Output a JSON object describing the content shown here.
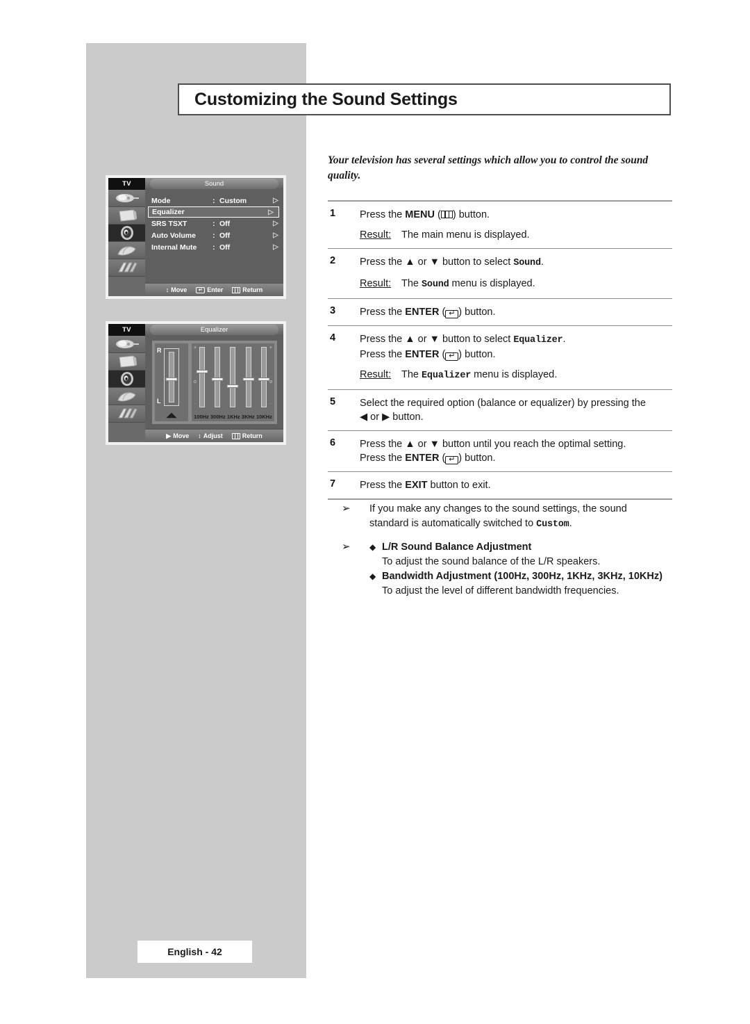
{
  "page": {
    "title": "Customizing the Sound Settings",
    "intro": "Your television has several settings which allow you to control the sound quality.",
    "footer": "English - 42"
  },
  "steps": [
    {
      "num": "1",
      "line1_pre": "Press the ",
      "line1_bold": "MENU",
      "line1_post": " button.",
      "icon": "menu-icon",
      "result_label": "Result:",
      "result_pre": "The main menu is displayed.",
      "result_mono": "",
      "result_post": ""
    },
    {
      "num": "2",
      "line1_pre": "Press the ",
      "line1_arrows": "▲ or ▼",
      "line1_mid": " button to select ",
      "line1_mono": "Sound",
      "line1_post": ".",
      "result_label": "Result:",
      "result_pre": "The ",
      "result_mono": "Sound",
      "result_post": " menu is displayed."
    },
    {
      "num": "3",
      "line1_pre": "Press the ",
      "line1_bold": "ENTER",
      "line1_post": " button.",
      "icon": "enter-icon"
    },
    {
      "num": "4",
      "line1_pre": "Press the ",
      "line1_arrows": "▲ or ▼",
      "line1_mid": " button to select ",
      "line1_mono": "Equalizer",
      "line1_post": ".",
      "line2_pre": "Press the ",
      "line2_bold": "ENTER",
      "line2_post": " button.",
      "result_label": "Result:",
      "result_pre": "The ",
      "result_mono": "Equalizer",
      "result_post": " menu is displayed."
    },
    {
      "num": "5",
      "text_l1": "Select the required option (balance or equalizer) by pressing the",
      "text_l2": "◀ or ▶ button."
    },
    {
      "num": "6",
      "line1_pre": "Press the ",
      "line1_arrows": "▲ or ▼",
      "line1_mid": " button until you reach the optimal setting.",
      "line2_pre": "Press the ",
      "line2_bold": "ENTER",
      "line2_post": " button."
    },
    {
      "num": "7",
      "line1_pre": "Press the ",
      "line1_bold": "EXIT",
      "line1_post": " button to exit."
    }
  ],
  "notes": {
    "arrow": "➢",
    "diamond": "◆",
    "note1_l1": "If you make any changes to the sound settings, the sound",
    "note1_l2_pre": "standard is automatically switched to ",
    "note1_l2_mono": "Custom",
    "note1_l2_post": ".",
    "bullets": [
      {
        "title": "L/R Sound Balance Adjustment",
        "desc": "To adjust the sound balance of the L/R speakers."
      },
      {
        "title": "Bandwidth Adjustment (100Hz, 300Hz, 1KHz, 3KHz, 10KHz)",
        "desc": "To adjust the level of different bandwidth frequencies."
      }
    ]
  },
  "osd_sound": {
    "tv_label": "TV",
    "title": "Sound",
    "sidebar_icons": [
      "input-source-icon",
      "picture-tv-icon",
      "sound-speaker-icon",
      "setup-icon",
      "pc-icon"
    ],
    "active_icon_index": 2,
    "rows": [
      {
        "label": "Mode",
        "colon": ":",
        "value": "Custom",
        "arrow": "▷",
        "selected": false
      },
      {
        "label": "Equalizer",
        "colon": "",
        "value": "",
        "arrow": "▷",
        "selected": true
      },
      {
        "label": "SRS TSXT",
        "colon": ":",
        "value": "Off",
        "arrow": "▷",
        "selected": false
      },
      {
        "label": "Auto Volume",
        "colon": ":",
        "value": "Off",
        "arrow": "▷",
        "selected": false
      },
      {
        "label": "Internal Mute",
        "colon": ":",
        "value": "Off",
        "arrow": "▷",
        "selected": false
      }
    ],
    "footer": [
      {
        "icon": "up-down-arrow-icon",
        "glyph": "↕",
        "label": "Move"
      },
      {
        "icon": "enter-key-icon",
        "glyph": "↵",
        "label": "Enter"
      },
      {
        "icon": "menu-key-icon",
        "glyph": "",
        "label": "Return"
      }
    ]
  },
  "osd_equalizer": {
    "tv_label": "TV",
    "title": "Equalizer",
    "sidebar_icons": [
      "input-source-icon",
      "picture-tv-icon",
      "sound-speaker-icon",
      "setup-icon",
      "pc-icon"
    ],
    "active_icon_index": 2,
    "balance": {
      "top_label": "R",
      "bottom_label": "L",
      "speaker_glyph": "◢◣",
      "position_pct": 50
    },
    "footer": [
      {
        "icon": "right-arrow-icon",
        "glyph": "▶",
        "label": "Move"
      },
      {
        "icon": "up-down-arrow-icon",
        "glyph": "↕",
        "label": "Adjust"
      },
      {
        "icon": "menu-key-icon",
        "glyph": "",
        "label": "Return"
      }
    ]
  },
  "chart_data": {
    "type": "bar",
    "title": "Equalizer band levels",
    "categories": [
      "100Hz",
      "300Hz",
      "1KHz",
      "3KHz",
      "10KHz"
    ],
    "values": [
      62,
      50,
      38,
      50,
      50
    ],
    "xlabel": "",
    "ylabel": "",
    "ylim": [
      0,
      100
    ],
    "grid": false,
    "annotations": [
      "+",
      "0",
      "-"
    ]
  }
}
